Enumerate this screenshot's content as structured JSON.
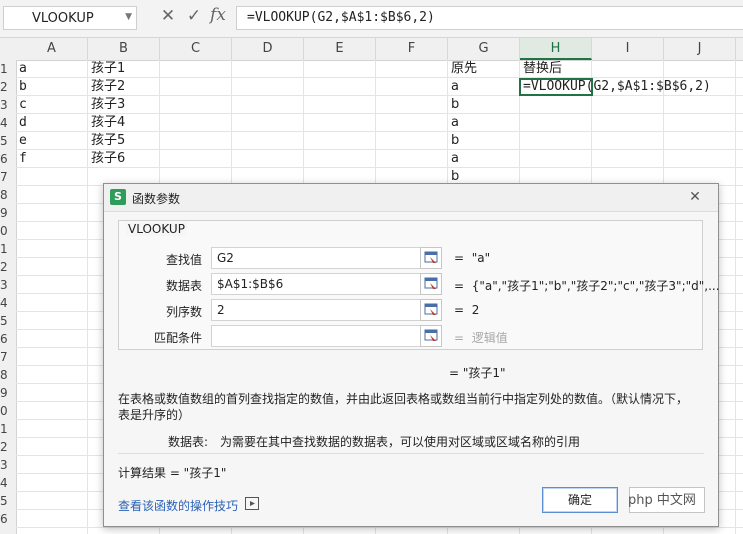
{
  "formula_bar": {
    "name_box": "VLOOKUP",
    "name_box_dropdown_icon": "chevron-down-icon",
    "cancel_icon": "✕",
    "confirm_icon": "✓",
    "fx_label": "fx",
    "formula": "=VLOOKUP(G2,$A$1:$B$6,2)"
  },
  "grid": {
    "columns": [
      "A",
      "B",
      "C",
      "D",
      "E",
      "F",
      "G",
      "H",
      "I",
      "J"
    ],
    "selected_column": "H",
    "rows": [
      "1",
      "2",
      "3",
      "4",
      "5",
      "6",
      "7",
      "8",
      "9",
      "0",
      "1",
      "2",
      "3",
      "4",
      "5",
      "6",
      "7",
      "8",
      "9",
      "0",
      "1",
      "2",
      "3",
      "4",
      "5",
      "6"
    ],
    "colA": [
      "a",
      "b",
      "c",
      "d",
      "e",
      "f"
    ],
    "colB": [
      "孩子1",
      "孩子2",
      "孩子3",
      "孩子4",
      "孩子5",
      "孩子6"
    ],
    "colG": [
      "原先",
      "a",
      "b",
      "a",
      "b",
      "a",
      "b"
    ],
    "H1": "替换后",
    "H2": "=VLOOKUP(G2,$A$1:$B$6,2)"
  },
  "dialog": {
    "title": "函数参数",
    "app_icon": "S",
    "function_name": "VLOOKUP",
    "args": [
      {
        "label": "查找值",
        "value": "G2",
        "result": "\"a\""
      },
      {
        "label": "数据表",
        "value": "$A$1:$B$6",
        "result": "{\"a\",\"孩子1\";\"b\",\"孩子2\";\"c\",\"孩子3\";\"d\",..."
      },
      {
        "label": "列序数",
        "value": "2",
        "result": "2"
      },
      {
        "label": "匹配条件",
        "value": "",
        "result": "逻辑值"
      }
    ],
    "eq": "=",
    "overall_result": "= \"孩子1\"",
    "description": "在表格或数值数组的首列查找指定的数值，并由此返回表格或数组当前行中指定列处的数值。（默认情况下，",
    "description2": "表是升序的）",
    "arg_help_label": "数据表:",
    "arg_help_text": "为需要在其中查找数据的数据表，可以使用对区域或区域名称的引用",
    "calc_result": "计算结果 = \"孩子1\"",
    "ok_label": "确定",
    "help_link": "查看该函数的操作技巧",
    "close_icon": "✕"
  },
  "watermark": "php 中文网"
}
